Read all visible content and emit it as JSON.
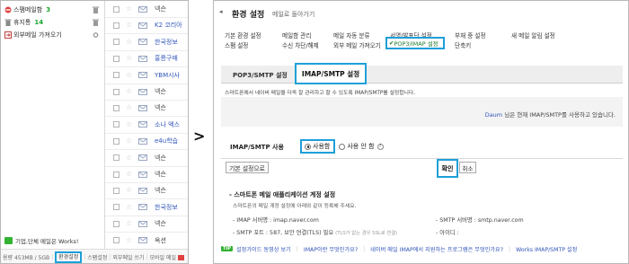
{
  "left": {
    "folders": [
      {
        "name": "스팸메일함",
        "count": "3",
        "icon": "spam-icon"
      },
      {
        "name": "휴지통",
        "count": "14",
        "icon": "trash-icon"
      },
      {
        "name": "외부메일 가져오기",
        "count": "",
        "icon": "external-mail-icon"
      }
    ],
    "promo_text": "기업,단체 메일은 Works!",
    "footer": {
      "usage": "용량 453MB / 5GB",
      "env_settings": "환경설정",
      "spam_settings": "스팸설정",
      "external_mail": "외부메일 쓰기",
      "mobile_mail": "모바일 메일"
    },
    "mail_senders": [
      {
        "text": "넥슨",
        "color": "dark"
      },
      {
        "text": "K2 코리아",
        "color": "blue"
      },
      {
        "text": "한국정보",
        "color": "blue"
      },
      {
        "text": "홍릉구매",
        "color": "blue"
      },
      {
        "text": "YBM시사",
        "color": "blue"
      },
      {
        "text": "넥슨",
        "color": "dark"
      },
      {
        "text": "넥슨",
        "color": "dark"
      },
      {
        "text": "소나 엑스",
        "color": "blue"
      },
      {
        "text": "e4u학습",
        "color": "blue"
      },
      {
        "text": "넥슨",
        "color": "dark"
      },
      {
        "text": "넥슨",
        "color": "dark"
      },
      {
        "text": "넥슨",
        "color": "dark"
      },
      {
        "text": "한국정보",
        "color": "blue"
      },
      {
        "text": "넥슨",
        "color": "dark"
      },
      {
        "text": "옥션",
        "color": "dark"
      }
    ]
  },
  "arrow": ">",
  "right": {
    "back_arrow": "◂",
    "title": "환경 설정",
    "back_link": "메일로 돌아가기",
    "menu": [
      "기본 환경 설정",
      "메일함 관리",
      "메일 자동 분류",
      "서명/발표단 설정",
      "부재 중 설정",
      "새 메일 알림 설정",
      "스팸 설정",
      "수신 차단/해제",
      "외부 메일 가져오기",
      "POP3/IMAP 설정",
      "단축키"
    ],
    "tab_pop3": "POP3/SMTP 설정",
    "tab_imap": "IMAP/SMTP 설정",
    "description": "스마트폰에서 네이버 메일을 더욱 잘 관리하고 할 수 있도록 IMAP/SMTP를 설정합니다.",
    "info_link": "Daum",
    "info_text": "님은 현재 IMAP/SMTP를 사용하고 있습니다.",
    "imap_label": "IMAP/SMTP 사용",
    "radio_use": "사용함",
    "radio_unuse": "사용 안 함",
    "help": "?",
    "btn_default": "기본 설정으로",
    "btn_confirm": "확인",
    "btn_cancel": "취소",
    "sub_title": "- 스마트폰 메일 애플리케이션 계정 설정",
    "sub_desc": "스마트폰의 메일 계정 설정에 아래와 같이 등록해 주세요.",
    "imap_server": "- IMAP 서버명 : imap.naver.com",
    "smtp_server": "- SMTP 서버명 : smtp.naver.com",
    "smtp_port": "- SMTP 포트 : 587, 보안 연결(TLS) 필요",
    "smtp_port_hint": "(TLS가 없는 경우 SSL로 연결)",
    "user_id": "- 아이디 :",
    "tip_badge": "TIP",
    "tips": [
      "설정가이드 동영상 보기",
      "IMAP이란 무엇인가요?",
      "네이버 메일 IMAP에서 지원하는 프로그램은 무엇인가요?",
      "Works IMAP/SMTP 설정"
    ]
  },
  "colors": {
    "highlight": "#1e9fd8",
    "link": "#2f54b8",
    "green": "#17a52b"
  }
}
